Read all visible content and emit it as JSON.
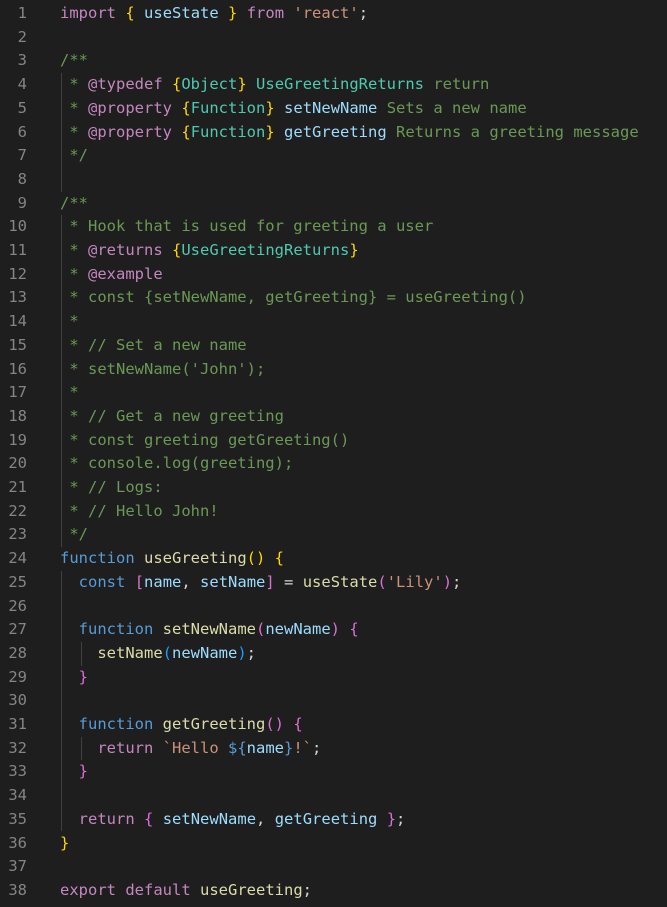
{
  "editor": {
    "language": "javascript",
    "theme": "dark",
    "colors": {
      "background": "#1e1e1e",
      "line_number": "#858585",
      "keyword": "#569cd6",
      "control_keyword": "#c586c0",
      "function": "#dcdcaa",
      "variable": "#9cdcfe",
      "string": "#ce9178",
      "comment": "#6a9955",
      "type": "#4ec9b0",
      "bracket_level_1": "#ffd700",
      "bracket_level_2": "#da70d6",
      "bracket_level_3": "#179fff"
    },
    "lines": [
      {
        "n": "1",
        "tokens": [
          [
            "import",
            "ctl"
          ],
          [
            " ",
            "pl"
          ],
          [
            "{",
            "b1"
          ],
          [
            " ",
            "pl"
          ],
          [
            "useState",
            "var"
          ],
          [
            " ",
            "pl"
          ],
          [
            "}",
            "b1"
          ],
          [
            " ",
            "pl"
          ],
          [
            "from",
            "ctl"
          ],
          [
            " ",
            "pl"
          ],
          [
            "'react'",
            "str"
          ],
          [
            ";",
            "pl"
          ]
        ]
      },
      {
        "n": "2",
        "tokens": []
      },
      {
        "n": "3",
        "tokens": [
          [
            "/**",
            "cm"
          ]
        ]
      },
      {
        "n": "4",
        "tokens": [
          [
            " * ",
            "cm"
          ],
          [
            "@typedef",
            "ctl"
          ],
          [
            " ",
            "cm"
          ],
          [
            "{",
            "b1"
          ],
          [
            "Object",
            "typ"
          ],
          [
            "}",
            "b1"
          ],
          [
            " ",
            "cm"
          ],
          [
            "UseGreetingReturns",
            "typ"
          ],
          [
            " return",
            "cm"
          ]
        ]
      },
      {
        "n": "5",
        "tokens": [
          [
            " * ",
            "cm"
          ],
          [
            "@property",
            "ctl"
          ],
          [
            " ",
            "cm"
          ],
          [
            "{",
            "b1"
          ],
          [
            "Function",
            "typ"
          ],
          [
            "}",
            "b1"
          ],
          [
            " ",
            "cm"
          ],
          [
            "setNewName",
            "var"
          ],
          [
            " Sets a new name",
            "cm"
          ]
        ]
      },
      {
        "n": "6",
        "tokens": [
          [
            " * ",
            "cm"
          ],
          [
            "@property",
            "ctl"
          ],
          [
            " ",
            "cm"
          ],
          [
            "{",
            "b1"
          ],
          [
            "Function",
            "typ"
          ],
          [
            "}",
            "b1"
          ],
          [
            " ",
            "cm"
          ],
          [
            "getGreeting",
            "var"
          ],
          [
            " Returns a greeting message",
            "cm"
          ]
        ]
      },
      {
        "n": "7",
        "tokens": [
          [
            " */",
            "cm"
          ]
        ]
      },
      {
        "n": "8",
        "tokens": []
      },
      {
        "n": "9",
        "tokens": [
          [
            "/**",
            "cm"
          ]
        ]
      },
      {
        "n": "10",
        "tokens": [
          [
            " * Hook that is used for greeting a user",
            "cm"
          ]
        ]
      },
      {
        "n": "11",
        "tokens": [
          [
            " * ",
            "cm"
          ],
          [
            "@returns",
            "ctl"
          ],
          [
            " ",
            "cm"
          ],
          [
            "{",
            "b1"
          ],
          [
            "UseGreetingReturns",
            "typ"
          ],
          [
            "}",
            "b1"
          ]
        ]
      },
      {
        "n": "12",
        "tokens": [
          [
            " * ",
            "cm"
          ],
          [
            "@example",
            "ctl"
          ]
        ]
      },
      {
        "n": "13",
        "tokens": [
          [
            " * const {setNewName, getGreeting} = useGreeting()",
            "cm"
          ]
        ]
      },
      {
        "n": "14",
        "tokens": [
          [
            " *",
            "cm"
          ]
        ]
      },
      {
        "n": "15",
        "tokens": [
          [
            " * // Set a new name",
            "cm"
          ]
        ]
      },
      {
        "n": "16",
        "tokens": [
          [
            " * setNewName('John');",
            "cm"
          ]
        ]
      },
      {
        "n": "17",
        "tokens": [
          [
            " *",
            "cm"
          ]
        ]
      },
      {
        "n": "18",
        "tokens": [
          [
            " * // Get a new greeting",
            "cm"
          ]
        ]
      },
      {
        "n": "19",
        "tokens": [
          [
            " * const greeting getGreeting()",
            "cm"
          ]
        ]
      },
      {
        "n": "20",
        "tokens": [
          [
            " * console.log(greeting);",
            "cm"
          ]
        ]
      },
      {
        "n": "21",
        "tokens": [
          [
            " * // Logs:",
            "cm"
          ]
        ]
      },
      {
        "n": "22",
        "tokens": [
          [
            " * // Hello John!",
            "cm"
          ]
        ]
      },
      {
        "n": "23",
        "tokens": [
          [
            " */",
            "cm"
          ]
        ]
      },
      {
        "n": "24",
        "tokens": [
          [
            "function",
            "kw"
          ],
          [
            " ",
            "pl"
          ],
          [
            "useGreeting",
            "fn"
          ],
          [
            "()",
            "b1"
          ],
          [
            " ",
            "pl"
          ],
          [
            "{",
            "b1"
          ]
        ]
      },
      {
        "n": "25",
        "tokens": [
          [
            "  ",
            "pl"
          ],
          [
            "const",
            "kw"
          ],
          [
            " ",
            "pl"
          ],
          [
            "[",
            "b2"
          ],
          [
            "name",
            "var"
          ],
          [
            ", ",
            "pl"
          ],
          [
            "setName",
            "var"
          ],
          [
            "]",
            "b2"
          ],
          [
            " = ",
            "pl"
          ],
          [
            "useState",
            "fn"
          ],
          [
            "(",
            "b2"
          ],
          [
            "'Lily'",
            "str"
          ],
          [
            ")",
            "b2"
          ],
          [
            ";",
            "pl"
          ]
        ]
      },
      {
        "n": "26",
        "tokens": []
      },
      {
        "n": "27",
        "tokens": [
          [
            "  ",
            "pl"
          ],
          [
            "function",
            "kw"
          ],
          [
            " ",
            "pl"
          ],
          [
            "setNewName",
            "fn"
          ],
          [
            "(",
            "b2"
          ],
          [
            "newName",
            "var"
          ],
          [
            ")",
            "b2"
          ],
          [
            " ",
            "pl"
          ],
          [
            "{",
            "b2"
          ]
        ]
      },
      {
        "n": "28",
        "tokens": [
          [
            "    ",
            "pl"
          ],
          [
            "setName",
            "fn"
          ],
          [
            "(",
            "b3"
          ],
          [
            "newName",
            "var"
          ],
          [
            ")",
            "b3"
          ],
          [
            ";",
            "pl"
          ]
        ]
      },
      {
        "n": "29",
        "tokens": [
          [
            "  ",
            "pl"
          ],
          [
            "}",
            "b2"
          ]
        ]
      },
      {
        "n": "30",
        "tokens": []
      },
      {
        "n": "31",
        "tokens": [
          [
            "  ",
            "pl"
          ],
          [
            "function",
            "kw"
          ],
          [
            " ",
            "pl"
          ],
          [
            "getGreeting",
            "fn"
          ],
          [
            "()",
            "b2"
          ],
          [
            " ",
            "pl"
          ],
          [
            "{",
            "b2"
          ]
        ]
      },
      {
        "n": "32",
        "tokens": [
          [
            "    ",
            "pl"
          ],
          [
            "return",
            "ctl"
          ],
          [
            " ",
            "pl"
          ],
          [
            "`Hello ",
            "str"
          ],
          [
            "${",
            "kw"
          ],
          [
            "name",
            "var"
          ],
          [
            "}",
            "kw"
          ],
          [
            "!`",
            "str"
          ],
          [
            ";",
            "pl"
          ]
        ]
      },
      {
        "n": "33",
        "tokens": [
          [
            "  ",
            "pl"
          ],
          [
            "}",
            "b2"
          ]
        ]
      },
      {
        "n": "34",
        "tokens": []
      },
      {
        "n": "35",
        "tokens": [
          [
            "  ",
            "pl"
          ],
          [
            "return",
            "ctl"
          ],
          [
            " ",
            "pl"
          ],
          [
            "{",
            "b2"
          ],
          [
            " ",
            "pl"
          ],
          [
            "setNewName",
            "var"
          ],
          [
            ", ",
            "pl"
          ],
          [
            "getGreeting",
            "var"
          ],
          [
            " ",
            "pl"
          ],
          [
            "}",
            "b2"
          ],
          [
            ";",
            "pl"
          ]
        ]
      },
      {
        "n": "36",
        "tokens": [
          [
            "}",
            "b1"
          ]
        ]
      },
      {
        "n": "37",
        "tokens": []
      },
      {
        "n": "38",
        "tokens": [
          [
            "export",
            "ctl"
          ],
          [
            " ",
            "pl"
          ],
          [
            "default",
            "ctl"
          ],
          [
            " ",
            "pl"
          ],
          [
            "useGreeting",
            "fn"
          ],
          [
            ";",
            "pl"
          ]
        ]
      }
    ]
  }
}
